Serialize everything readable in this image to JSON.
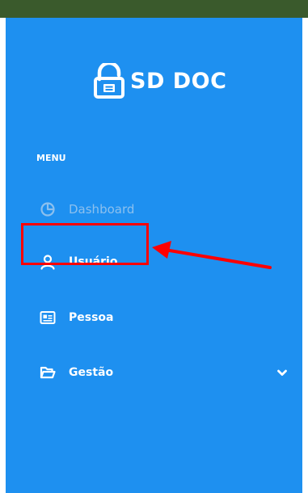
{
  "brand": {
    "name": "SD DOC",
    "icon": "lock-document-icon"
  },
  "menu": {
    "heading": "MENU",
    "items": [
      {
        "label": "Dashboard",
        "icon": "pie-chart-icon",
        "state": "dimmed"
      },
      {
        "label": "Usuário",
        "icon": "user-icon",
        "state": "highlighted"
      },
      {
        "label": "Pessoa",
        "icon": "id-card-icon",
        "state": "normal"
      },
      {
        "label": "Gestão",
        "icon": "folder-open-icon",
        "state": "normal",
        "expandable": true,
        "expand_icon": "chevron-down-icon"
      }
    ]
  },
  "colors": {
    "sidebar_bg": "#1e90f0",
    "top_strip": "#3a5a2c",
    "text": "#ffffff",
    "dimmed_text": "#8cc0ee",
    "annotation": "#ff0000"
  }
}
